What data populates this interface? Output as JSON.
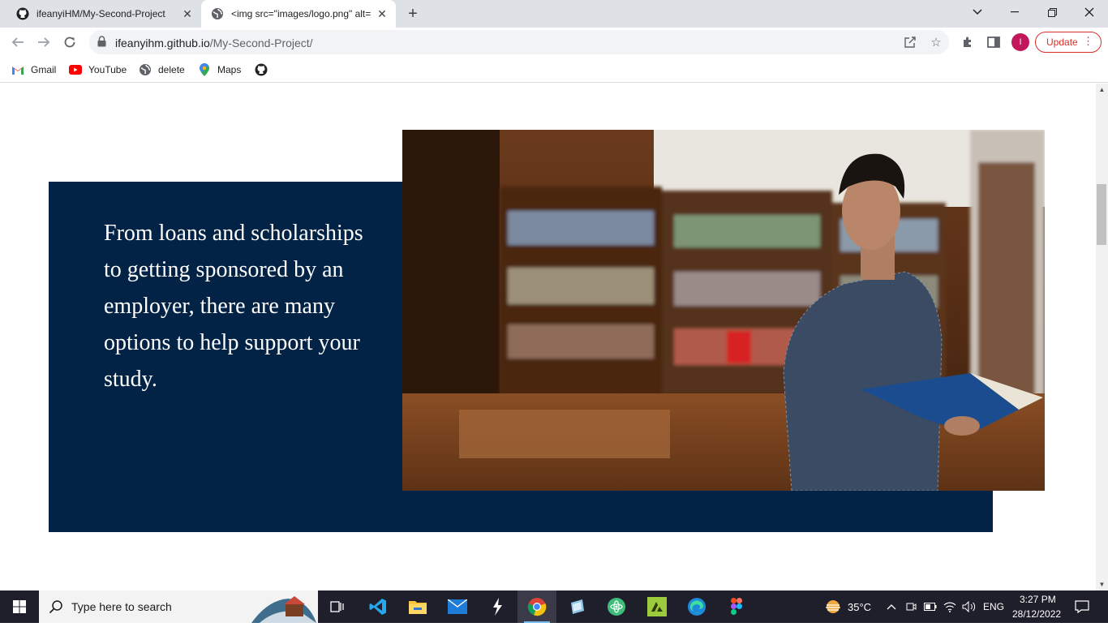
{
  "browser": {
    "tabs": [
      {
        "title": "ifeanyiHM/My-Second-Project",
        "active": false
      },
      {
        "title": "<img src=\"images/logo.png\" alt=",
        "active": true
      }
    ],
    "new_tab_label": "+",
    "url_host": "ifeanyihm.github.io",
    "url_path": "/My-Second-Project/",
    "profile_initial": "I",
    "update_label": "Update",
    "bookmarks": [
      {
        "label": "Gmail",
        "icon": "gmail-icon"
      },
      {
        "label": "YouTube",
        "icon": "youtube-icon"
      },
      {
        "label": "delete",
        "icon": "globe-icon"
      },
      {
        "label": "Maps",
        "icon": "maps-icon"
      },
      {
        "label": "",
        "icon": "github-icon"
      }
    ]
  },
  "page": {
    "hero_text": "From loans and scholarships to getting sponsored by an employer, there are many options to help support your study.",
    "image_alt": "student reading a book in a library",
    "colors": {
      "navy": "#022345"
    }
  },
  "taskbar": {
    "search_placeholder": "Type here to search",
    "weather": "35°C",
    "language": "ENG",
    "time": "3:27 PM",
    "date": "28/12/2022"
  }
}
